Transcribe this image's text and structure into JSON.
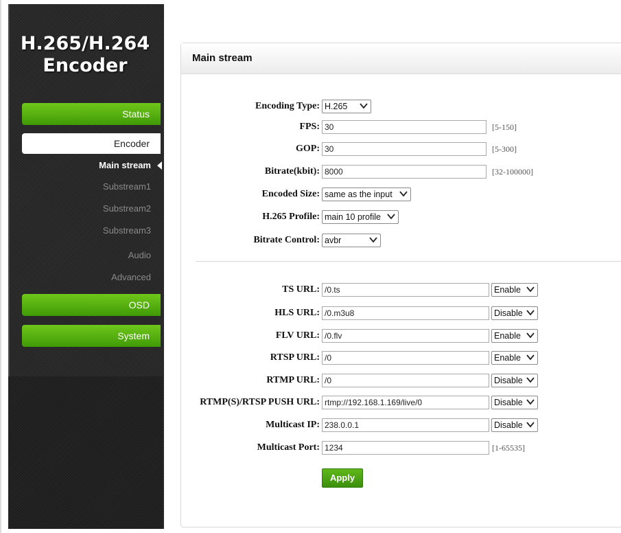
{
  "app": {
    "logo_line1": "H.265/H.264",
    "logo_line2": "Encoder"
  },
  "sidebar": {
    "status": "Status",
    "encoder": "Encoder",
    "subitems": [
      "Main stream",
      "Substream1",
      "Substream2",
      "Substream3",
      "Audio",
      "Advanced"
    ],
    "osd": "OSD",
    "system": "System"
  },
  "panel": {
    "title": "Main stream"
  },
  "encoding": {
    "type": {
      "label": "Encoding Type:",
      "value": "H.265"
    },
    "fps": {
      "label": "FPS:",
      "value": "30",
      "range": "[5-150]"
    },
    "gop": {
      "label": "GOP:",
      "value": "30",
      "range": "[5-300]"
    },
    "bitrate": {
      "label": "Bitrate(kbit):",
      "value": "8000",
      "range": "[32-100000]"
    },
    "size": {
      "label": "Encoded Size:",
      "value": "same as the input"
    },
    "profile": {
      "label": "H.265 Profile:",
      "value": "main 10 profile"
    },
    "control": {
      "label": "Bitrate Control:",
      "value": "avbr"
    }
  },
  "urls": {
    "ts": {
      "label": "TS URL:",
      "value": "/0.ts",
      "state": "Enable"
    },
    "hls": {
      "label": "HLS URL:",
      "value": "/0.m3u8",
      "state": "Disable"
    },
    "flv": {
      "label": "FLV URL:",
      "value": "/0.flv",
      "state": "Enable"
    },
    "rtsp": {
      "label": "RTSP URL:",
      "value": "/0",
      "state": "Enable"
    },
    "rtmp": {
      "label": "RTMP URL:",
      "value": "/0",
      "state": "Disable"
    },
    "push": {
      "label": "RTMP(S)/RTSP PUSH URL:",
      "value": "rtmp://192.168.1.169/live/0",
      "state": "Disable"
    },
    "mcast_ip": {
      "label": "Multicast IP:",
      "value": "238.0.0.1",
      "state": "Disable"
    },
    "mcast_port": {
      "label": "Multicast Port:",
      "value": "1234",
      "range": "[1-65535]"
    }
  },
  "apply_label": "Apply",
  "colors": {
    "accent": "#4fa811",
    "sidebar": "#2a2a2a"
  }
}
